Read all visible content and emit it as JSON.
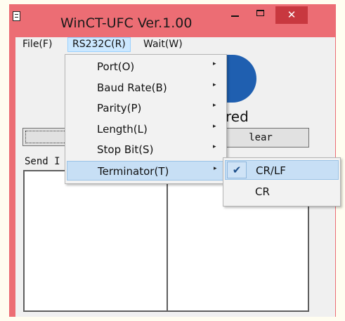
{
  "window": {
    "title": "WinCT-UFC  Ver.1.00",
    "close_glyph": "✕"
  },
  "menubar": {
    "items": [
      "File(F)",
      "RS232C(R)",
      "Wait(W)"
    ],
    "active": "RS232C(R)"
  },
  "rs232c_menu": {
    "items": [
      {
        "label": "Port(O)",
        "has_submenu": true
      },
      {
        "label": "Baud Rate(B)",
        "has_submenu": true
      },
      {
        "label": "Parity(P)",
        "has_submenu": true
      },
      {
        "label": "Length(L)",
        "has_submenu": true
      },
      {
        "label": "Stop Bit(S)",
        "has_submenu": true
      },
      {
        "label": "Terminator(T)",
        "has_submenu": true,
        "highlighted": true
      }
    ],
    "arrow_glyph": "▸"
  },
  "terminator_submenu": {
    "items": [
      {
        "label": "CR/LF",
        "checked": true,
        "highlighted": true
      },
      {
        "label": "CR",
        "checked": false
      }
    ],
    "check_glyph": "✔"
  },
  "background_content": {
    "logo_caption_partial": "red",
    "clear_button_partial": "lear",
    "send_label_partial": "Send I"
  },
  "colors": {
    "frame": "#ec6d74",
    "close_button": "#c8383f",
    "menu_highlight": "#c7dff5",
    "logo_blue": "#1f5fb0"
  }
}
